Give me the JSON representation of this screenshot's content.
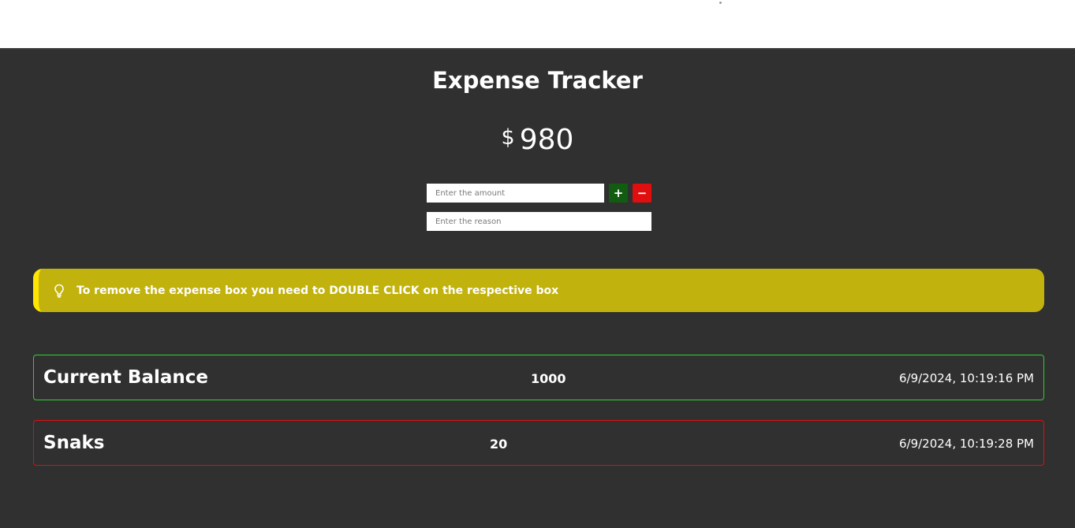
{
  "header": {
    "title": "Expense Tracker"
  },
  "balance": {
    "currency_symbol": "$",
    "amount": "980"
  },
  "form": {
    "amount_placeholder": "Enter the amount",
    "reason_placeholder": "Enter the reason",
    "add_label": "+",
    "subtract_label": "−"
  },
  "tip": {
    "icon": "lightbulb-icon",
    "text": "To remove the expense box you need to DOUBLE CLICK on the respective box"
  },
  "colors": {
    "background": "#303030",
    "add_button": "#125c12",
    "subtract_button": "#e00e0e",
    "tip_background": "#c2b20d",
    "tip_accent": "#ffe600",
    "income_border": "#2fd02f",
    "expense_border": "#e00e0e"
  },
  "entries": [
    {
      "name": "Current Balance",
      "amount": "1000",
      "timestamp": "6/9/2024, 10:19:16 PM",
      "type": "income"
    },
    {
      "name": "Snaks",
      "amount": "20",
      "timestamp": "6/9/2024, 10:19:28 PM",
      "type": "expense"
    }
  ]
}
